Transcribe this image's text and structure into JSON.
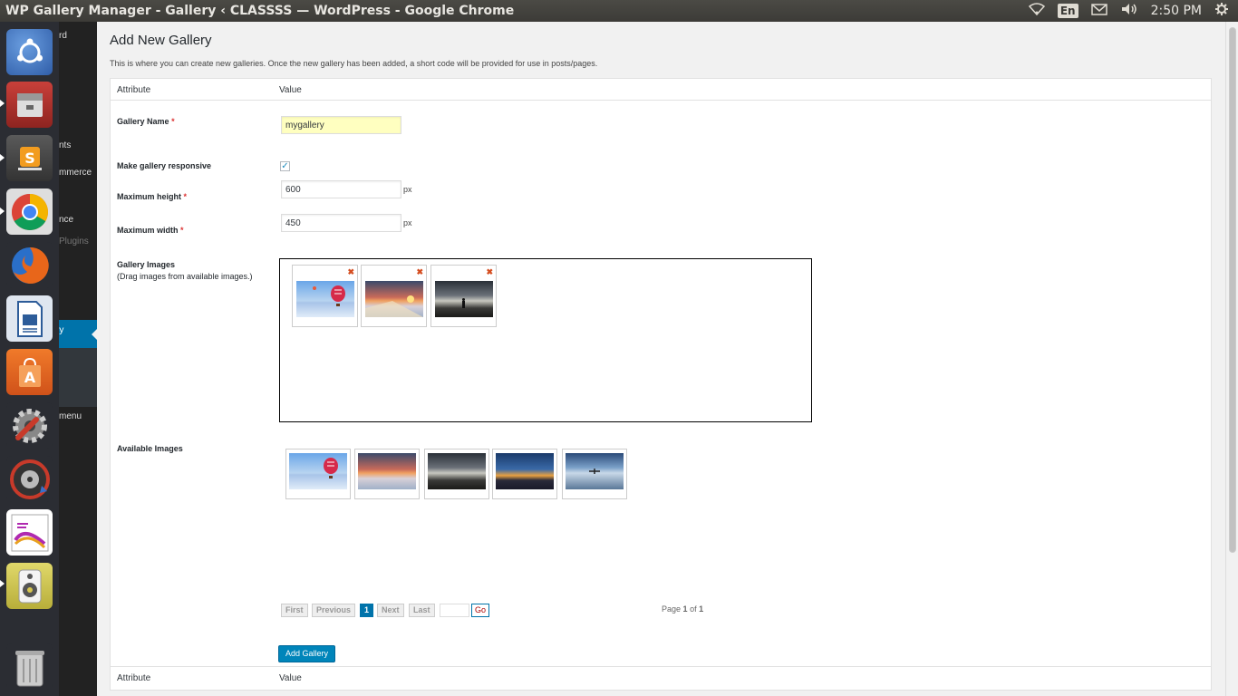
{
  "window": {
    "title": "WP Gallery Manager - Gallery ‹ CLASSSS — WordPress - Google Chrome",
    "indicators": {
      "language": "En",
      "time": "2:50 PM"
    }
  },
  "launcher": {
    "apps": [
      {
        "name": "ubuntu-dash-icon",
        "color": "#3d6cb8"
      },
      {
        "name": "files-icon",
        "color": "#b5312a"
      },
      {
        "name": "sublime-text-icon",
        "color": "#4a4a4a"
      },
      {
        "name": "chrome-icon",
        "color": "#e8a020"
      },
      {
        "name": "firefox-icon",
        "color": "#d46a1a"
      },
      {
        "name": "libreoffice-writer-icon",
        "color": "#2d5c99"
      },
      {
        "name": "software-center-icon",
        "color": "#e0641c"
      },
      {
        "name": "system-settings-icon",
        "color": "#555"
      },
      {
        "name": "backup-icon",
        "color": "#444"
      },
      {
        "name": "image-viewer-icon",
        "color": "#fff"
      },
      {
        "name": "audio-player-icon",
        "color": "#d8c850"
      },
      {
        "name": "trash-icon",
        "color": "#555"
      }
    ]
  },
  "wp_sidebar": {
    "items": [
      "rd",
      "nts",
      "mmerce",
      "nce",
      "Plugins",
      "ry",
      "Gallery",
      "menu"
    ]
  },
  "page": {
    "title": "Add New Gallery",
    "description": "This is where you can create new galleries. Once the new gallery has been added, a short code will be provided for use in posts/pages."
  },
  "table": {
    "col_attribute": "Attribute",
    "col_value": "Value"
  },
  "form": {
    "gallery_name_label": "Gallery Name",
    "required_mark": "*",
    "gallery_name_value": "mygallery",
    "responsive_label": "Make gallery responsive",
    "responsive_checked": true,
    "check_glyph": "✓",
    "max_height_label": "Maximum height",
    "max_height_value": "600",
    "max_width_label": "Maximum width",
    "max_width_value": "450",
    "unit": "px",
    "gallery_images_label": "Gallery Images",
    "gallery_images_hint": "(Drag images from available images.)",
    "remove_glyph": "✖",
    "available_images_label": "Available Images",
    "add_button": "Add Gallery"
  },
  "gallery_images": [
    {
      "name": "hot-air-balloon-image"
    },
    {
      "name": "sunset-road-image"
    },
    {
      "name": "stormy-sky-person-image"
    }
  ],
  "available_images": [
    {
      "name": "hot-air-balloon-image"
    },
    {
      "name": "sunset-road-image"
    },
    {
      "name": "stormy-sky-person-image"
    },
    {
      "name": "city-lights-dusk-image"
    },
    {
      "name": "airplane-over-water-image"
    }
  ],
  "pagination": {
    "first": "First",
    "previous": "Previous",
    "current": "1",
    "next": "Next",
    "last": "Last",
    "go": "Go",
    "page_prefix": "Page",
    "page_current": "1",
    "page_of": "of",
    "page_total": "1"
  }
}
